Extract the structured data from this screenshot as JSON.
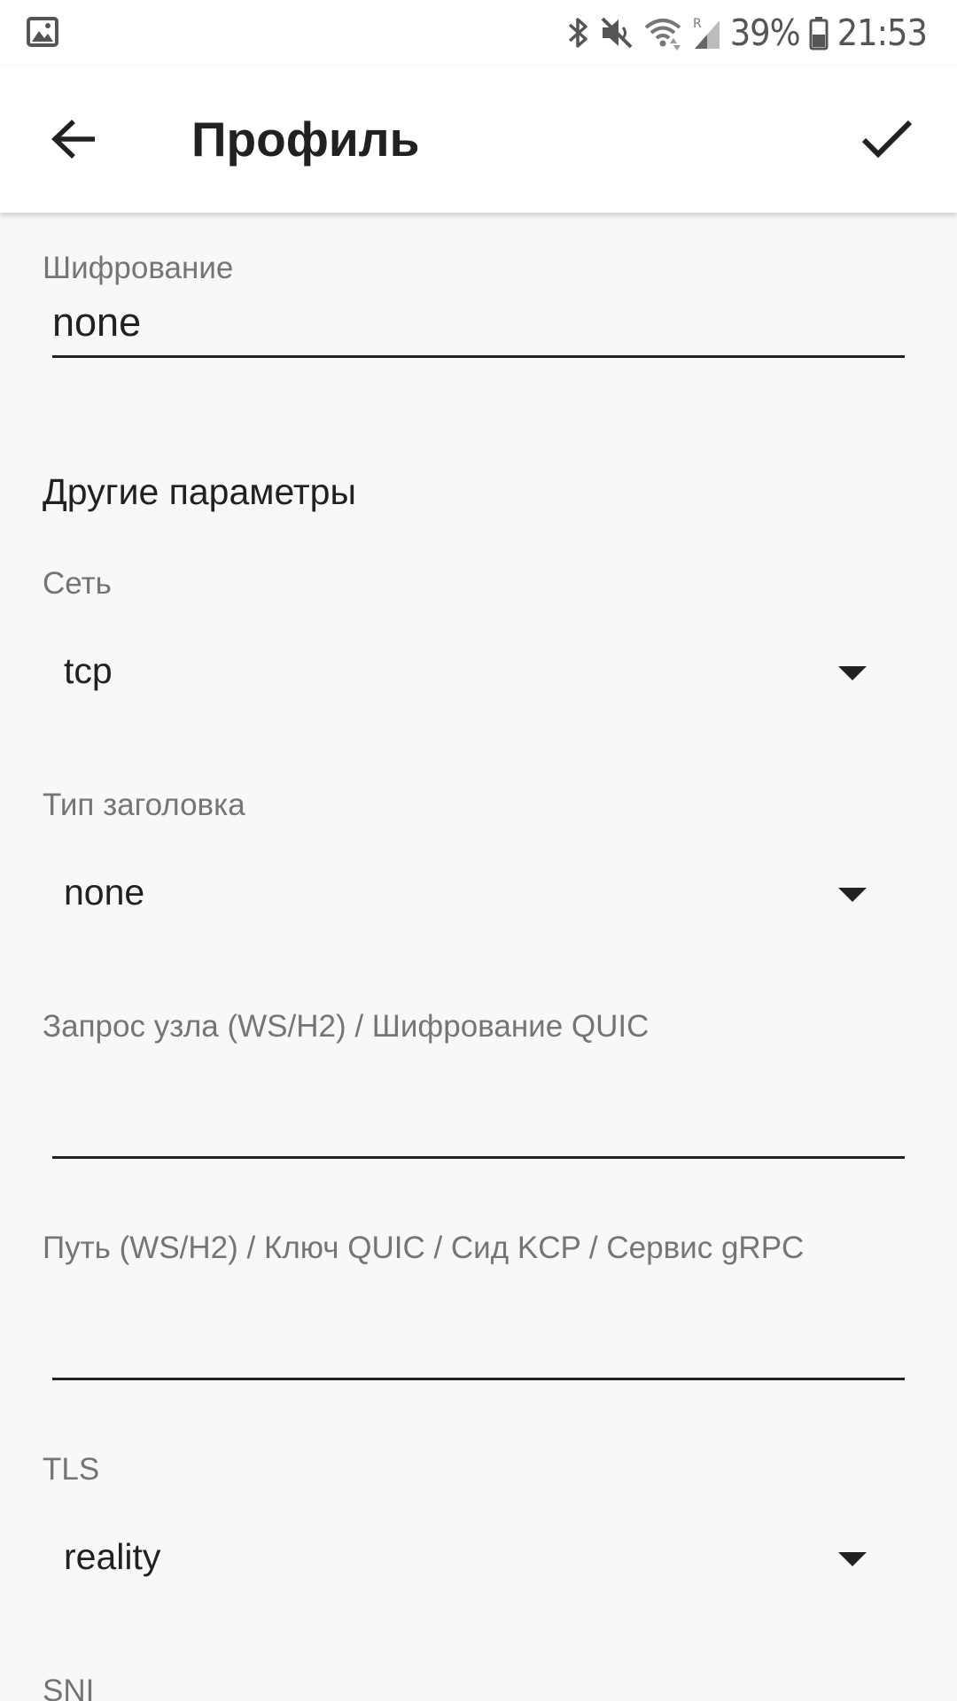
{
  "status_bar": {
    "battery_percent": "39%",
    "time": "21:53",
    "icons": [
      "gallery-icon",
      "bluetooth-icon",
      "mute-icon",
      "wifi-icon",
      "signal-icon",
      "battery-icon"
    ]
  },
  "app_bar": {
    "title": "Профиль",
    "back_icon": "arrow-back-icon",
    "confirm_icon": "check-icon"
  },
  "form": {
    "encryption": {
      "label": "Шифрование",
      "value": "none"
    },
    "other_params_title": "Другие параметры",
    "network": {
      "label": "Сеть",
      "value": "tcp"
    },
    "header_type": {
      "label": "Тип заголовка",
      "value": "none"
    },
    "host_request": {
      "label": "Запрос узла (WS/H2) / Шифрование QUIC",
      "value": ""
    },
    "path": {
      "label": "Путь (WS/H2) / Ключ QUIC / Сид KCP / Сервис gRPC",
      "value": ""
    },
    "tls": {
      "label": "TLS",
      "value": "reality"
    },
    "sni": {
      "label": "SNI"
    }
  },
  "colors": {
    "background": "#f8f8f8",
    "app_bar": "#ffffff",
    "text_primary": "#212121",
    "text_secondary": "#757575"
  }
}
